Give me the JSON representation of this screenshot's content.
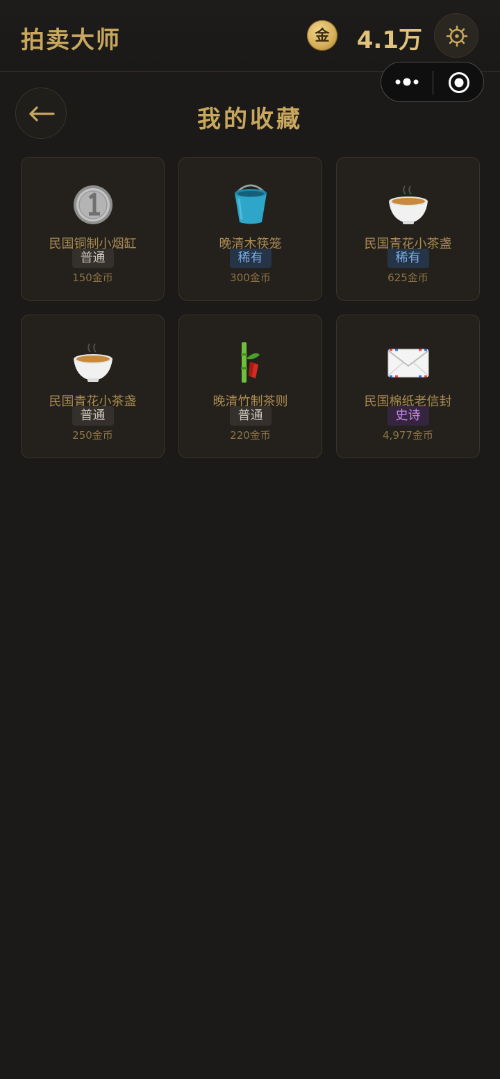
{
  "header": {
    "title": "拍卖大师",
    "coin_label": "金",
    "balance": "4.1万",
    "settings_icon": "gear-icon"
  },
  "capsule": {
    "more_icon": "more-dots-icon",
    "close_icon": "close-circle-icon"
  },
  "page": {
    "title": "我的收藏",
    "back_icon": "arrow-left-icon"
  },
  "colors": {
    "gold": "#c9a85e",
    "background": "#1b1a19",
    "card": "#24211c",
    "common": "#c9c3b8",
    "rare": "#79aee6",
    "epic": "#c98ae6"
  },
  "items": [
    {
      "icon": "coin-one-icon",
      "name": "民国铜制小烟缸",
      "rarity": "普通",
      "price": "150金币"
    },
    {
      "icon": "bucket-icon",
      "name": "晚清木筷笼",
      "rarity": "稀有",
      "price": "300金币"
    },
    {
      "icon": "teacup-icon",
      "name": "民国青花小茶盏",
      "rarity": "稀有",
      "price": "625金币"
    },
    {
      "icon": "teacup-icon",
      "name": "民国青花小茶盏",
      "rarity": "普通",
      "price": "250金币"
    },
    {
      "icon": "bamboo-icon",
      "name": "晚清竹制茶则",
      "rarity": "普通",
      "price": "220金币"
    },
    {
      "icon": "envelope-icon",
      "name": "民国棉纸老信封",
      "rarity": "史诗",
      "price": "4,977金币"
    }
  ]
}
